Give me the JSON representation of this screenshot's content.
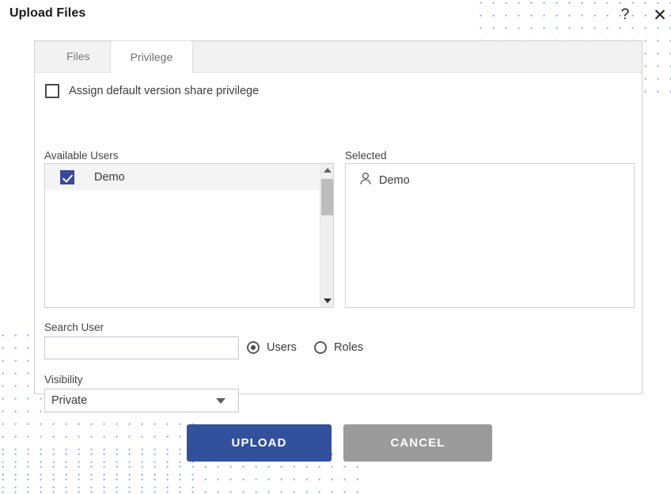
{
  "dialog": {
    "title": "Upload Files",
    "help_icon": "question-mark-icon",
    "close_icon": "close-x-icon",
    "help_glyph": "?",
    "close_glyph": "✕"
  },
  "tabs": [
    {
      "label": "Files",
      "active": false
    },
    {
      "label": "Privilege",
      "active": true
    }
  ],
  "assign_privilege": {
    "label": "Assign default version share privilege",
    "checked": false
  },
  "available_users": {
    "label": "Available Users",
    "items": [
      {
        "name": "Demo",
        "checked": true
      }
    ]
  },
  "selected_users": {
    "label": "Selected",
    "items": [
      {
        "name": "Demo",
        "icon": "user-icon"
      }
    ]
  },
  "search_user": {
    "label": "Search User",
    "value": "",
    "placeholder": ""
  },
  "search_scope": {
    "options": [
      {
        "label": "Users",
        "selected": true
      },
      {
        "label": "Roles",
        "selected": false
      }
    ]
  },
  "visibility": {
    "label": "Visibility",
    "value": "Private"
  },
  "actions": {
    "upload_label": "UPLOAD",
    "cancel_label": "CANCEL"
  },
  "colors": {
    "primary": "#32509b",
    "checkbox_blue": "#39499b",
    "cancel_gray": "#9b9b9b",
    "tab_strip": "#f2f2f2",
    "dot_pattern": "#9aa6dd"
  }
}
